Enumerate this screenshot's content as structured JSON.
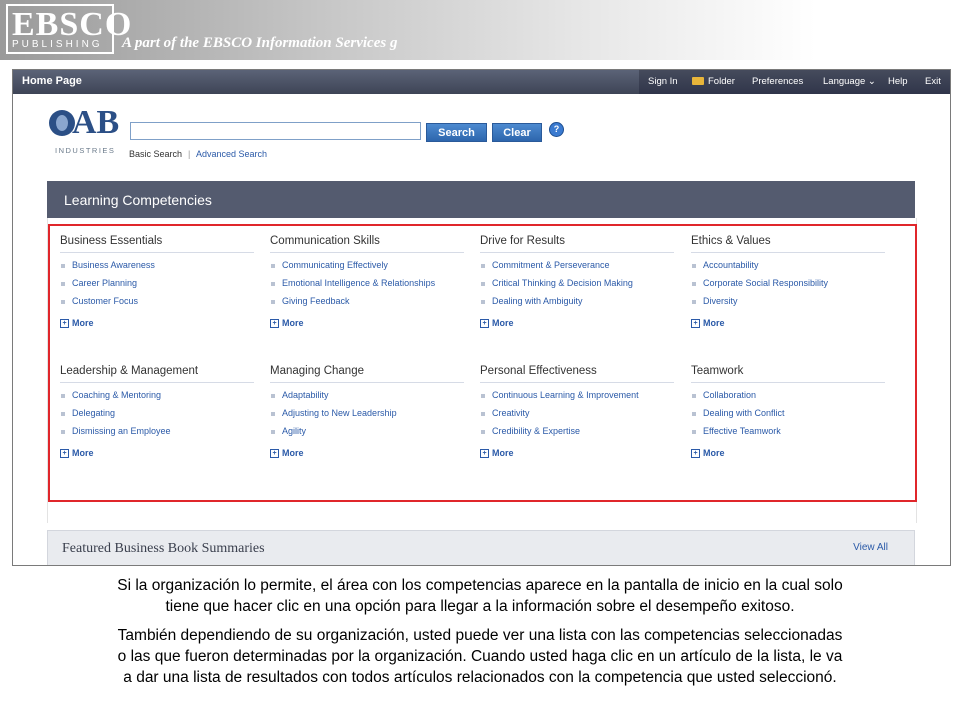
{
  "banner": {
    "logo_main": "EBSCO",
    "logo_sub": "PUBLISHING",
    "tagline": "A part of the EBSCO Information Services g"
  },
  "topnav": {
    "home": "Home Page",
    "sign_in": "Sign In",
    "folder": "Folder",
    "preferences": "Preferences",
    "language": "Language",
    "help": "Help",
    "exit": "Exit"
  },
  "brand": {
    "letters": "AB",
    "sub": "INDUSTRIES"
  },
  "search": {
    "value": "",
    "search_button": "Search",
    "clear_button": "Clear",
    "help_icon": "?",
    "basic_link": "Basic Search",
    "advanced_link": "Advanced Search"
  },
  "learning": {
    "title": "Learning Competencies",
    "more_label": "More",
    "categories": [
      {
        "title": "Business Essentials",
        "items": [
          "Business Awareness",
          "Career Planning",
          "Customer Focus"
        ]
      },
      {
        "title": "Communication Skills",
        "items": [
          "Communicating Effectively",
          "Emotional Intelligence & Relationships",
          "Giving Feedback"
        ]
      },
      {
        "title": "Drive for Results",
        "items": [
          "Commitment & Perseverance",
          "Critical Thinking & Decision Making",
          "Dealing with Ambiguity"
        ]
      },
      {
        "title": "Ethics & Values",
        "items": [
          "Accountability",
          "Corporate Social Responsibility",
          "Diversity"
        ]
      },
      {
        "title": "Leadership & Management",
        "items": [
          "Coaching & Mentoring",
          "Delegating",
          "Dismissing an Employee"
        ]
      },
      {
        "title": "Managing Change",
        "items": [
          "Adaptability",
          "Adjusting to New Leadership",
          "Agility"
        ]
      },
      {
        "title": "Personal Effectiveness",
        "items": [
          "Continuous Learning & Improvement",
          "Creativity",
          "Credibility & Expertise"
        ]
      },
      {
        "title": "Teamwork",
        "items": [
          "Collaboration",
          "Dealing with Conflict",
          "Effective Teamwork"
        ]
      }
    ]
  },
  "featured": {
    "title": "Featured Business Book Summaries",
    "view_all": "View All"
  },
  "caption": {
    "p1_line1": "Si la organización lo permite, el área con los competencias aparece en la pantalla de inicio en la cual solo",
    "p1_line2": "tiene que hacer clic en una opción para llegar a la información sobre el desempeño exitoso.",
    "p2_line1": "También dependiendo de su organización, usted puede ver una lista con las competencias seleccionadas",
    "p2_line2": "o las que fueron determinadas por la organización. Cuando usted haga clic en un artículo de la lista, le va",
    "p2_line3": "a dar una lista de resultados con todos artículos relacionados con la competencia que usted seleccionó."
  },
  "colors": {
    "nav_bar": "#4a5165",
    "section_header": "#545b6f",
    "link": "#2b5aa8",
    "highlight_border": "#e0262b",
    "button": "#3a78c2"
  }
}
